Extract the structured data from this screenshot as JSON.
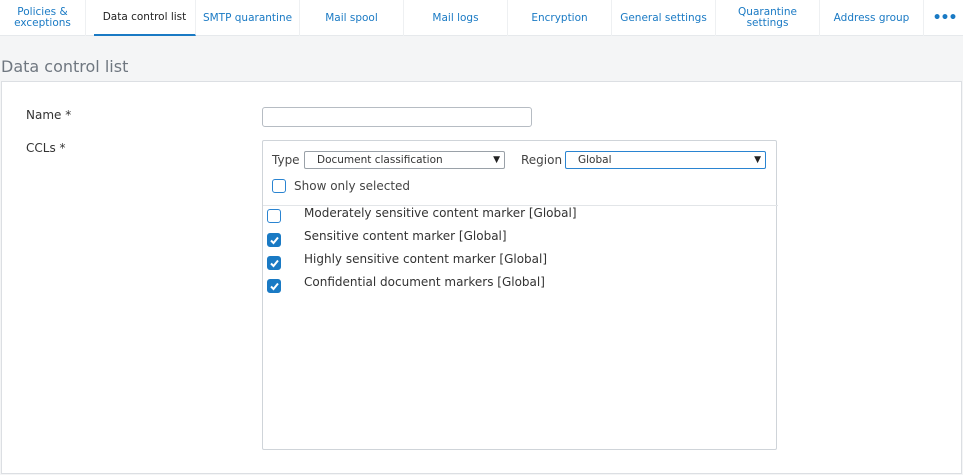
{
  "tabs": [
    {
      "label": "Policies &\nexceptions"
    },
    {
      "label": "Data control list"
    },
    {
      "label": "SMTP quarantine"
    },
    {
      "label": "Mail spool"
    },
    {
      "label": "Mail logs"
    },
    {
      "label": "Encryption"
    },
    {
      "label": "General settings"
    },
    {
      "label": "Quarantine settings"
    },
    {
      "label": "Address group"
    }
  ],
  "more_label": "•••",
  "page_title": "Data control list",
  "form": {
    "name_label": "Name *",
    "name_value": "",
    "ccls_label": "CCLs *",
    "type_label": "Type",
    "type_value": "Document classification",
    "region_label": "Region",
    "region_value": "Global",
    "show_only_selected_label": "Show only selected",
    "show_only_selected_checked": false,
    "items": [
      {
        "label": "Moderately sensitive content marker [Global]",
        "checked": false
      },
      {
        "label": "Sensitive content marker [Global]",
        "checked": true
      },
      {
        "label": "Highly sensitive content marker [Global]",
        "checked": true
      },
      {
        "label": "Confidential document markers [Global]",
        "checked": true
      }
    ]
  },
  "colors": {
    "accent": "#1a7ac4",
    "background": "#f4f5f6"
  }
}
